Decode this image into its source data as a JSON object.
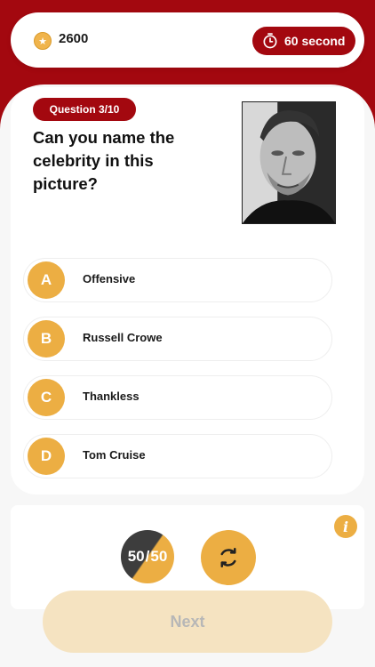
{
  "header": {
    "coins": "2600",
    "timer_label": "60 second"
  },
  "question": {
    "badge": "Question 3/10",
    "text": "Can you name the celebrity in this picture?"
  },
  "options": [
    {
      "letter": "A",
      "label": "Offensive"
    },
    {
      "letter": "B",
      "label": "Russell Crowe"
    },
    {
      "letter": "C",
      "label": "Thankless"
    },
    {
      "letter": "D",
      "label": "Tom Cruise"
    }
  ],
  "lifelines": {
    "fifty_left": "50",
    "fifty_right": "50"
  },
  "footer": {
    "next_label": "Next"
  },
  "colors": {
    "brand_red": "#a3080f",
    "accent_gold": "#ecae43"
  }
}
